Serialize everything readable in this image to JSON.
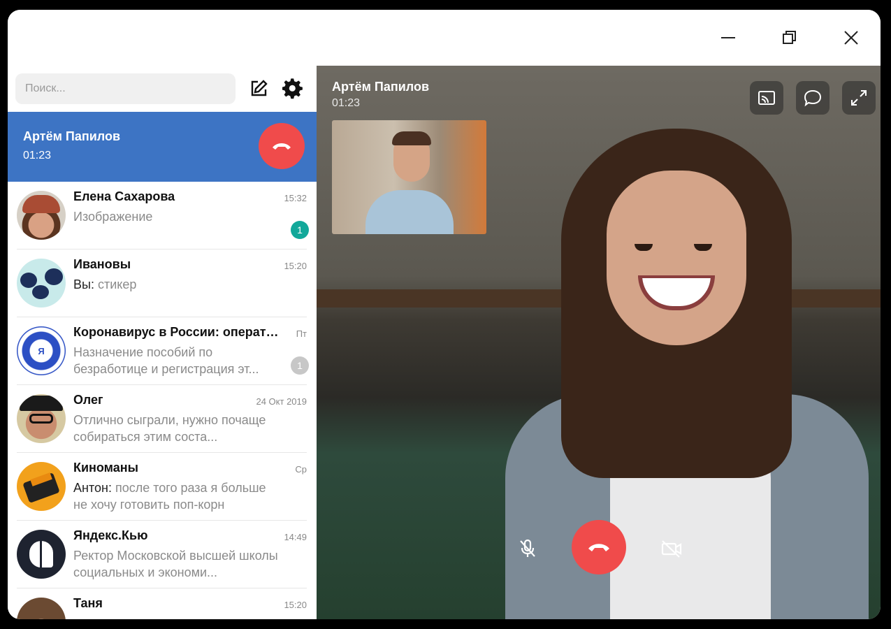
{
  "window": {
    "controls": {
      "minimize": "minimize-icon",
      "restore": "restore-icon",
      "close": "close-icon"
    }
  },
  "sidebar": {
    "search_placeholder": "Поиск...",
    "active_call": {
      "name": "Артём Папилов",
      "time": "01:23"
    },
    "chats": [
      {
        "name": "Елена Сахарова",
        "time": "15:32",
        "prefix": "",
        "preview": "Изображение",
        "badge": "1",
        "badge_color": "#12a89a"
      },
      {
        "name": "Ивановы",
        "time": "15:20",
        "prefix": "Вы: ",
        "preview": "стикер",
        "badge": "",
        "badge_color": ""
      },
      {
        "name": "Коронавирус в России: оперативно",
        "time": "Пт",
        "prefix": "",
        "preview": "Назначение пособий по безработице и регистрация эт...",
        "badge": "1",
        "badge_color": "#c7c7c7"
      },
      {
        "name": "Олег",
        "time": "24 Окт 2019",
        "prefix": "",
        "preview": "Отлично сыграли, нужно почаще собираться этим соста...",
        "badge": "",
        "badge_color": ""
      },
      {
        "name": "Киноманы",
        "time": "Ср",
        "prefix": "Антон: ",
        "preview": "после того раза я больше не хочу готовить поп-корн",
        "badge": "",
        "badge_color": ""
      },
      {
        "name": "Яндекс.Кью",
        "time": "14:49",
        "prefix": "",
        "preview": "Ректор Московской высшей школы социальных и экономи...",
        "badge": "",
        "badge_color": ""
      },
      {
        "name": "Таня",
        "time": "15:20",
        "prefix": "",
        "preview": "",
        "badge": "",
        "badge_color": ""
      }
    ]
  },
  "call": {
    "caller_name": "Артём Папилов",
    "duration": "01:23",
    "accent_hangup": "#f04b4b",
    "accent_active": "#3d74c4"
  }
}
